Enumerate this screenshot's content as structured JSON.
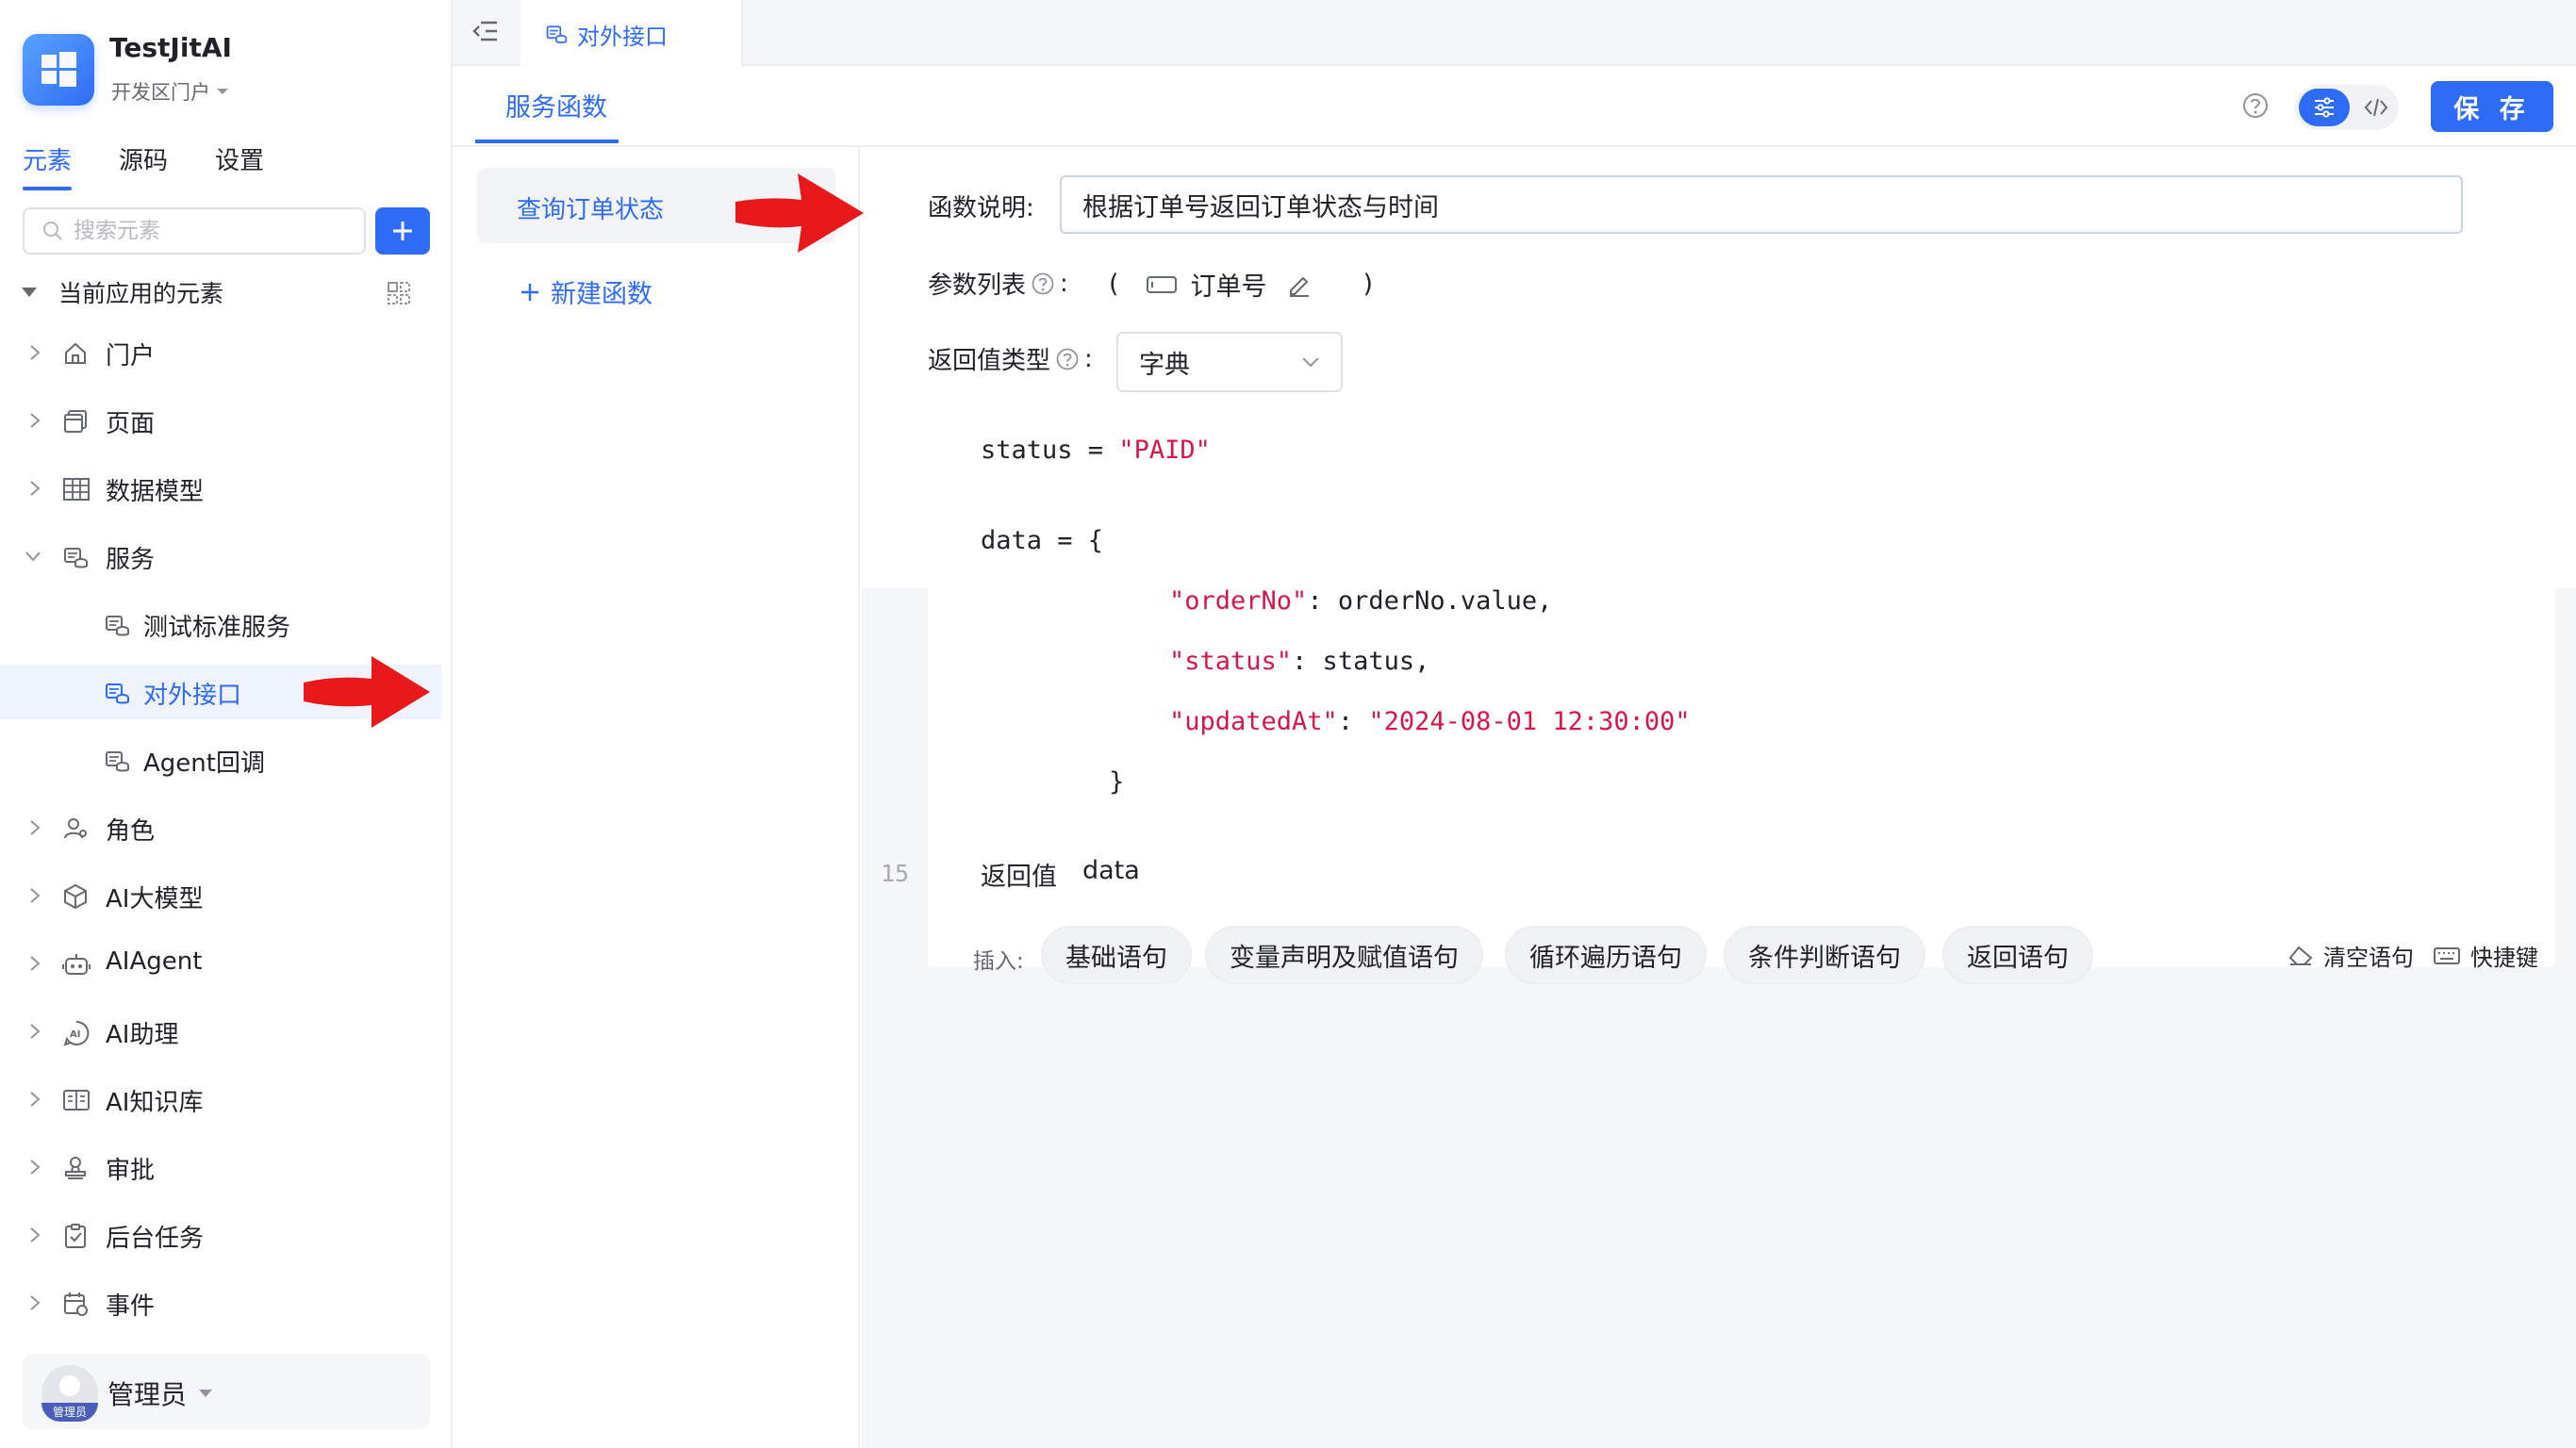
{
  "app": {
    "name": "TestJitAI",
    "portal": "开发区门户"
  },
  "sidebar": {
    "tabs": [
      "元素",
      "源码",
      "设置"
    ],
    "search_placeholder": "搜索元素",
    "group_title": "当前应用的元素",
    "items": [
      {
        "label": "门户",
        "icon": "home-icon"
      },
      {
        "label": "页面",
        "icon": "page-icon"
      },
      {
        "label": "数据模型",
        "icon": "table-icon"
      },
      {
        "label": "服务",
        "icon": "service-icon"
      },
      {
        "label": "测试标准服务",
        "icon": "service-icon"
      },
      {
        "label": "对外接口",
        "icon": "service-icon"
      },
      {
        "label": "Agent回调",
        "icon": "service-icon"
      },
      {
        "label": "角色",
        "icon": "role-icon"
      },
      {
        "label": "AI大模型",
        "icon": "cube-icon"
      },
      {
        "label": "AIAgent",
        "icon": "robot-icon"
      },
      {
        "label": "AI助理",
        "icon": "ai-assistant-icon"
      },
      {
        "label": "AI知识库",
        "icon": "book-icon"
      },
      {
        "label": "审批",
        "icon": "stamp-icon"
      },
      {
        "label": "后台任务",
        "icon": "clipboard-icon"
      },
      {
        "label": "事件",
        "icon": "calendar-icon"
      }
    ],
    "user": {
      "name": "管理员",
      "avatar_tag": "管理员"
    }
  },
  "tabstrip": {
    "active_tab": "对外接口"
  },
  "subheader": {
    "tab": "服务函数",
    "save_label": "保 存"
  },
  "functions": {
    "items": [
      "查询订单状态"
    ],
    "new_label": "新建函数"
  },
  "editor": {
    "desc_label": "函数说明:",
    "desc_value": "根据订单号返回订单状态与时间",
    "params_label": "参数列表",
    "params_open": "(",
    "params_close": ")",
    "param_name": "订单号",
    "return_type_label": "返回值类型",
    "return_type_colon": ":",
    "params_colon": ":",
    "return_type_value": "字典",
    "code": {
      "line1_var": "status",
      "line1_op": " = ",
      "line1_str": "\"PAID\"",
      "line2": "data = {",
      "k1": "\"orderNo\"",
      "v1": ": orderNo.value,",
      "k2": "\"status\"",
      "v2": ": status,",
      "k3": "\"updatedAt\"",
      "v3_sep": ": ",
      "v3": "\"2024-08-01 12:30:00\"",
      "close": "}"
    },
    "line_number": "15",
    "return_label": "返回值",
    "return_value": "data",
    "insert_label": "插入:",
    "chips": [
      "基础语句",
      "变量声明及赋值语句",
      "循环遍历语句",
      "条件判断语句",
      "返回语句"
    ],
    "clear_label": "清空语句",
    "shortcut_label": "快捷键"
  },
  "colors": {
    "accent": "#2f6cf5",
    "string": "#d6174c",
    "arrow": "#e8191b"
  }
}
